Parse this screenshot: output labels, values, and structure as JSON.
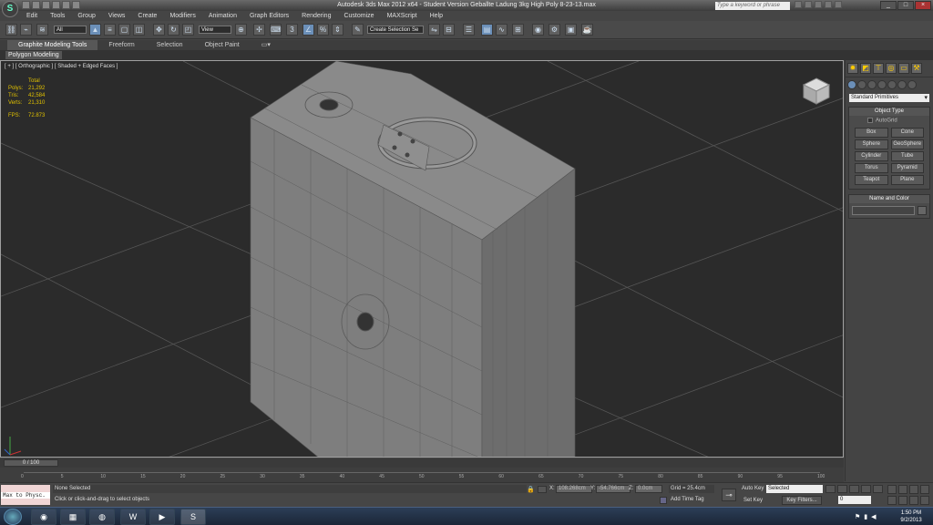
{
  "window": {
    "title": "Autodesk 3ds Max  2012 x64   -  Student Version    Geballte Ladung 3kg High Poly 8-23-13.max",
    "search_placeholder": "Type a keyword or phrase"
  },
  "menu": [
    "Edit",
    "Tools",
    "Group",
    "Views",
    "Create",
    "Modifiers",
    "Animation",
    "Graph Editors",
    "Rendering",
    "Customize",
    "MAXScript",
    "Help"
  ],
  "toolbar": {
    "selection_filter": "All",
    "reference_coord": "View",
    "selection_set": "Create Selection Se"
  },
  "ribbon": {
    "tabs": [
      "Graphite Modeling Tools",
      "Freeform",
      "Selection",
      "Object Paint"
    ],
    "active_tab": "Graphite Modeling Tools",
    "panel": "Polygon Modeling"
  },
  "viewport": {
    "label": "[ + ] [ Orthographic ] [ Shaded + Edged Faces ]",
    "stats": {
      "total_label": "Total",
      "rows": [
        {
          "k": "Polys:",
          "v": "21,292"
        },
        {
          "k": "Tris:",
          "v": "42,584"
        },
        {
          "k": "Verts:",
          "v": "21,310"
        }
      ],
      "fps_label": "FPS:",
      "fps": "72.873"
    }
  },
  "command_panel": {
    "category": "Standard Primitives",
    "object_type_title": "Object Type",
    "autogrid": "AutoGrid",
    "objects": [
      "Box",
      "Cone",
      "Sphere",
      "GeoSphere",
      "Cylinder",
      "Tube",
      "Torus",
      "Pyramid",
      "Teapot",
      "Plane"
    ],
    "name_color_title": "Name and Color"
  },
  "timeline": {
    "slider": "0 / 100",
    "ticks": [
      "0",
      "5",
      "10",
      "15",
      "20",
      "25",
      "30",
      "35",
      "40",
      "45",
      "50",
      "55",
      "60",
      "65",
      "70",
      "75",
      "80",
      "85",
      "90",
      "95",
      "100"
    ]
  },
  "status": {
    "maxscript": "Max to Physc.",
    "selection": "None Selected",
    "prompt": "Click or click-and-drag to select objects",
    "x_label": "X:",
    "x": "108.268cm",
    "y_label": "Y:",
    "y": "-54.766cm",
    "z_label": "Z:",
    "z": "0.0cm",
    "grid": "Grid = 25.4cm",
    "add_time_tag": "Add Time Tag",
    "auto_key": "Auto Key",
    "set_key": "Set Key",
    "key_mode": "Selected",
    "key_filters": "Key Filters...",
    "frame": "0"
  },
  "taskbar": {
    "time": "1:50 PM",
    "date": "9/2/2013"
  }
}
